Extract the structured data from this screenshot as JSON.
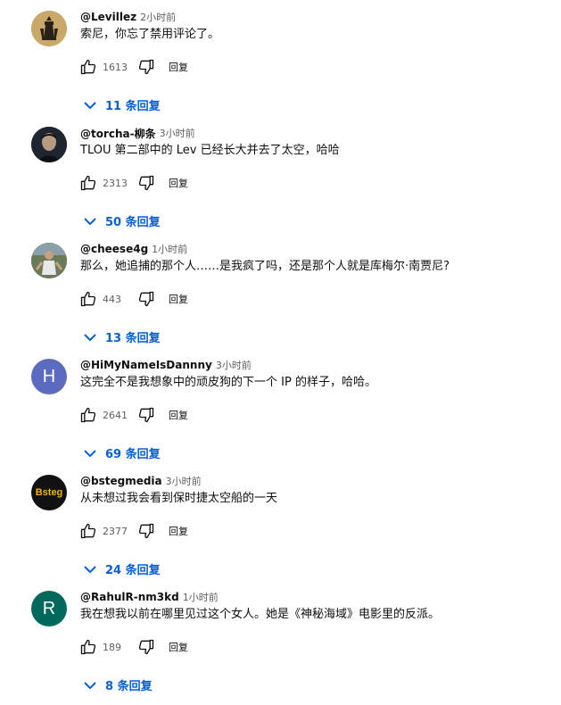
{
  "comments": [
    {
      "author": "@Levillez",
      "time": "2小时前",
      "text": "索尼，你忘了禁用评论了。",
      "likes": "1613",
      "reply": "回复",
      "replies": "11 条回复",
      "avatar_letter": "",
      "avatar_color": "#c9a86a"
    },
    {
      "author": "@torcha-柳条",
      "time": "3小时前",
      "text": "TLOU 第二部中的 Lev 已经长大并去了太空，哈哈",
      "likes": "2313",
      "reply": "回复",
      "replies": "50 条回复",
      "avatar_letter": "",
      "avatar_color": "#1f2630"
    },
    {
      "author": "@cheese4g",
      "time": "1小时前",
      "text": "那么，她追捕的那个人……是我疯了吗，还是那个人就是库梅尔·南贾尼?",
      "likes": "443",
      "reply": "回复",
      "replies": "13 条回复",
      "avatar_letter": "",
      "avatar_color": "#5a6a4a"
    },
    {
      "author": "@HiMyNameIsDannny",
      "time": "3小时前",
      "text": "这完全不是我想象中的顽皮狗的下一个 IP 的样子，哈哈。",
      "likes": "2641",
      "reply": "回复",
      "replies": "69 条回复",
      "avatar_letter": "H",
      "avatar_color": "#5c6bc0"
    },
    {
      "author": "@bstegmedia",
      "time": "3小时前",
      "text": "从未想过我会看到保时捷太空船的一天",
      "likes": "2377",
      "reply": "回复",
      "replies": "24 条回复",
      "avatar_letter": "Bsteg",
      "avatar_color": "#111111"
    },
    {
      "author": "@RahulR-nm3kd",
      "time": "1小时前",
      "text": "我在想我以前在哪里见过这个女人。她是《神秘海域》电影里的反派。",
      "likes": "189",
      "reply": "回复",
      "replies": "8 条回复",
      "avatar_letter": "R",
      "avatar_color": "#00695c"
    }
  ],
  "colors": {
    "link": "#065fd4",
    "secondary_text": "#606060",
    "primary_text": "#0f0f0f",
    "bsteg_text": "#f2b10a"
  },
  "icons": {
    "like": "thumbs-up-icon",
    "dislike": "thumbs-down-icon",
    "expand": "chevron-down-icon"
  }
}
